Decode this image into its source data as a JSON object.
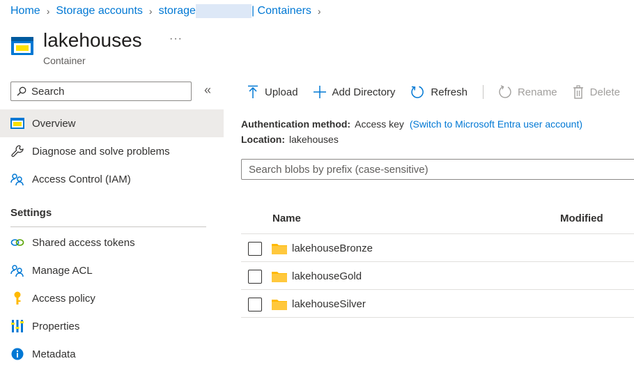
{
  "breadcrumb": {
    "home": "Home",
    "storage_accounts": "Storage accounts",
    "storage_prefix": "storage",
    "containers": "| Containers"
  },
  "header": {
    "title": "lakehouses",
    "subtitle": "Container",
    "more": "···"
  },
  "sidebar": {
    "search_placeholder": "Search",
    "collapse": "«",
    "items": [
      {
        "label": "Overview"
      },
      {
        "label": "Diagnose and solve problems"
      },
      {
        "label": "Access Control (IAM)"
      }
    ],
    "settings_header": "Settings",
    "settings_items": [
      {
        "label": "Shared access tokens"
      },
      {
        "label": "Manage ACL"
      },
      {
        "label": "Access policy"
      },
      {
        "label": "Properties"
      },
      {
        "label": "Metadata"
      }
    ]
  },
  "toolbar": {
    "upload": "Upload",
    "add_directory": "Add Directory",
    "refresh": "Refresh",
    "rename": "Rename",
    "delete": "Delete"
  },
  "info": {
    "auth_label": "Authentication method:",
    "auth_value": "Access key",
    "auth_switch": "(Switch to Microsoft Entra user account)",
    "location_label": "Location:",
    "location_value": "lakehouses"
  },
  "blob_search_placeholder": "Search blobs by prefix (case-sensitive)",
  "table": {
    "columns": [
      "Name",
      "Modified"
    ],
    "rows": [
      {
        "name": "lakehouseBronze"
      },
      {
        "name": "lakehouseGold"
      },
      {
        "name": "lakehouseSilver"
      }
    ]
  },
  "colors": {
    "accent": "#0078d4",
    "selected_bg": "#edebe9",
    "folder": "#ffb900"
  }
}
